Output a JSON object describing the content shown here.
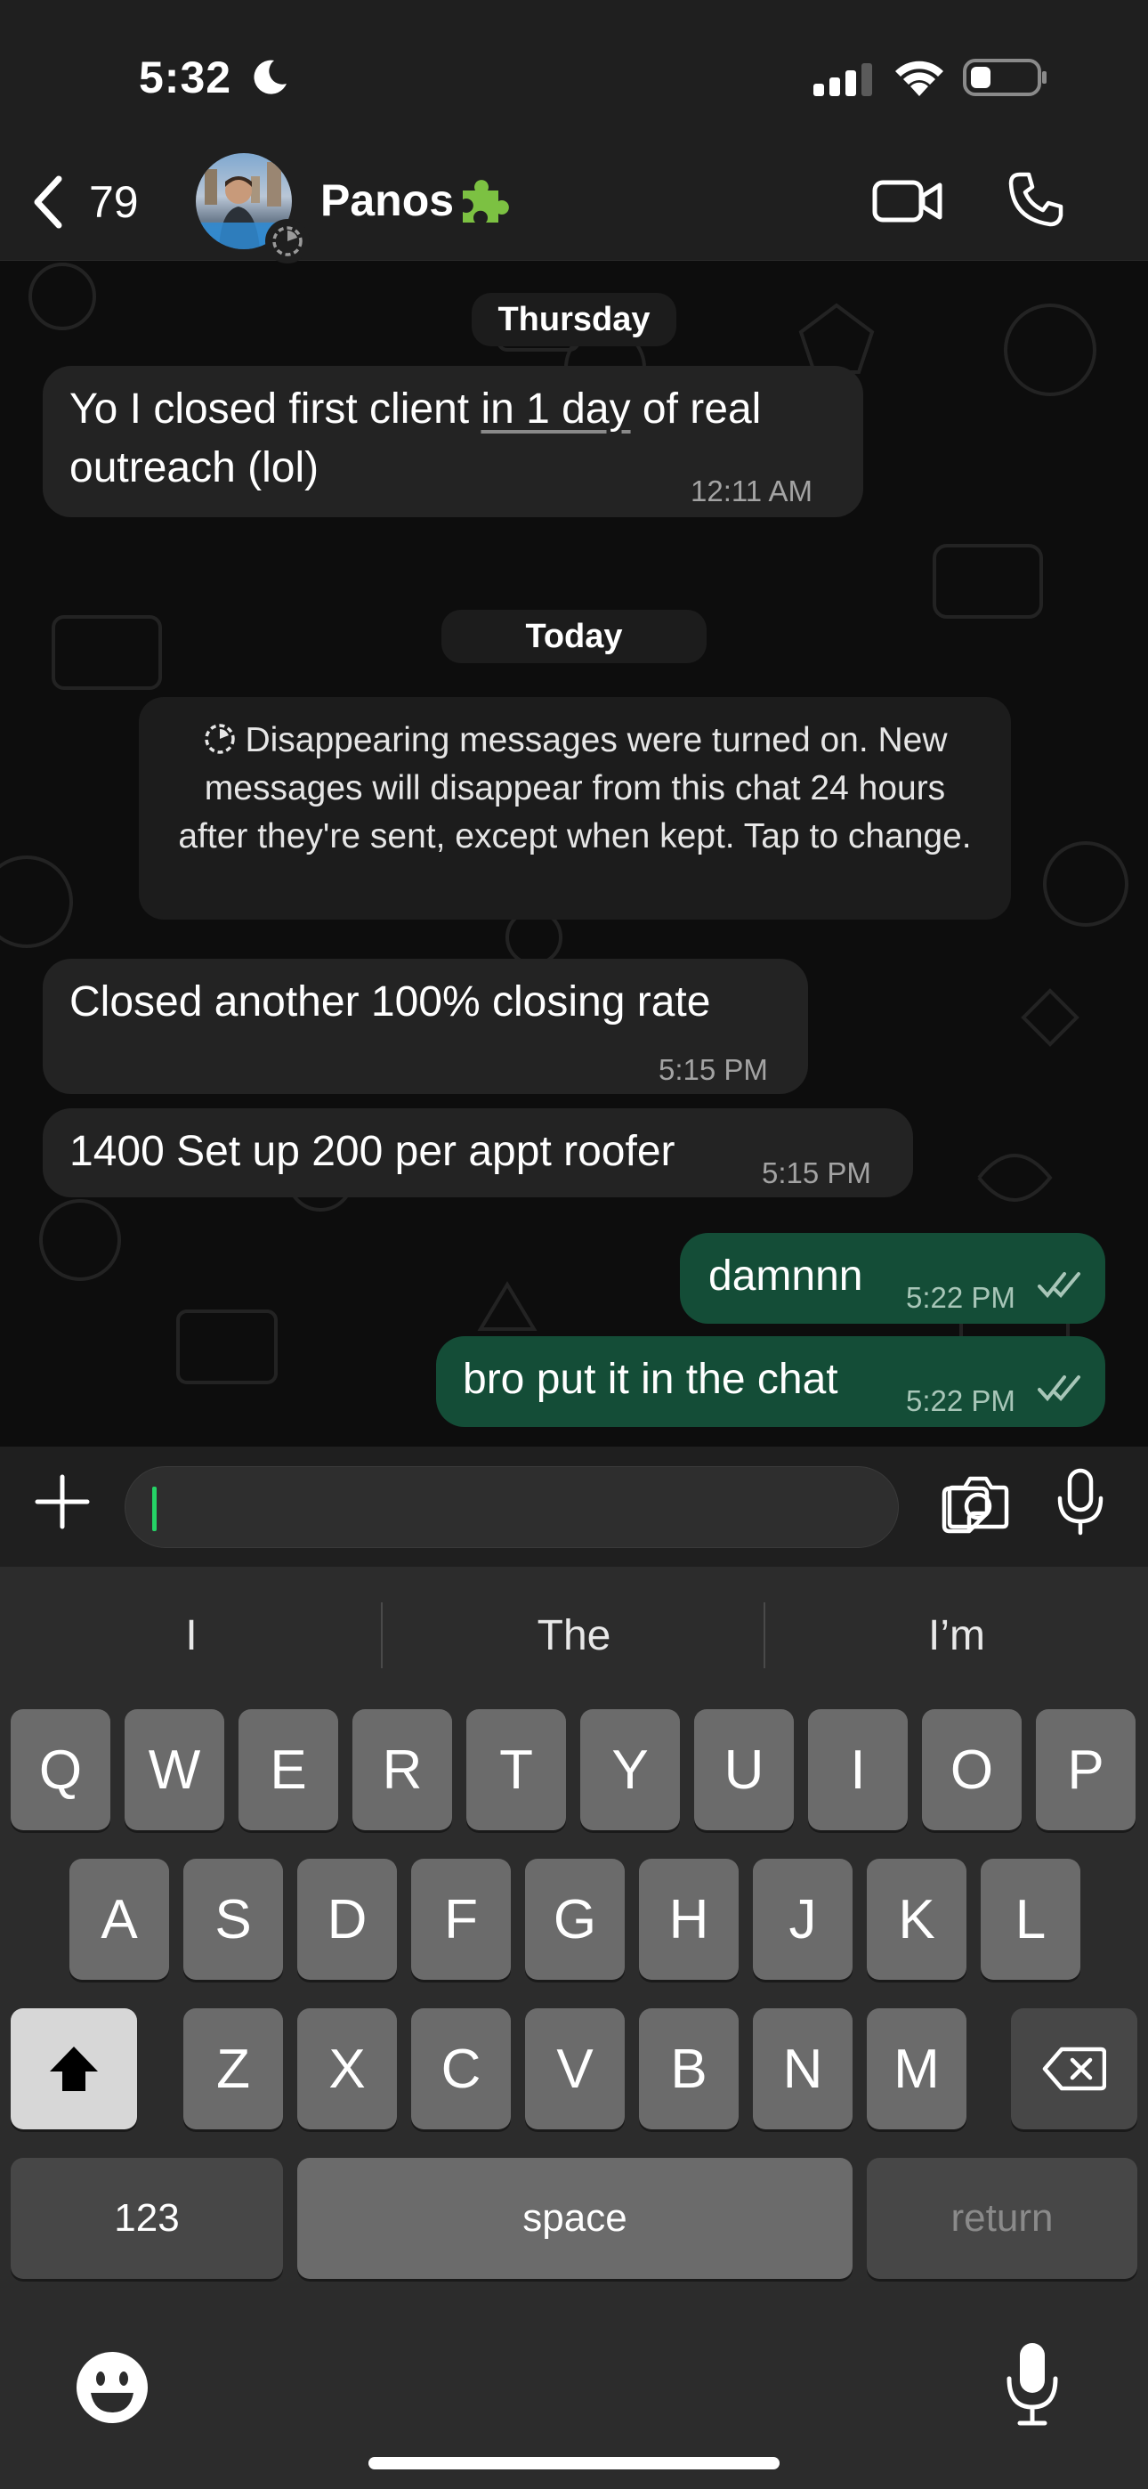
{
  "status": {
    "time": "5:32"
  },
  "header": {
    "back_count": "79",
    "contact_name": "Panos"
  },
  "chat": {
    "date_thursday": "Thursday",
    "date_today": "Today",
    "msg1": {
      "text_a": "Yo I closed first client ",
      "text_u": "in 1 day",
      "text_b": " of real outreach (lol)",
      "time": "12:11 AM"
    },
    "system_note": "Disappearing messages were turned on. New messages will disappear from this chat 24 hours after they're sent, except when kept. Tap to change.",
    "msg2": {
      "text": "Closed another 100% closing rate",
      "time": "5:15 PM"
    },
    "msg3": {
      "text": "1400 Set up 200 per appt roofer",
      "time": "5:15 PM"
    },
    "msg4": {
      "text": "damnnn",
      "time": "5:22 PM"
    },
    "msg5": {
      "text": "bro put it in the chat",
      "time": "5:22 PM"
    }
  },
  "keyboard": {
    "suggestions": [
      "I",
      "The",
      "I’m"
    ],
    "row1": [
      "Q",
      "W",
      "E",
      "R",
      "T",
      "Y",
      "U",
      "I",
      "O",
      "P"
    ],
    "row2": [
      "A",
      "S",
      "D",
      "F",
      "G",
      "H",
      "J",
      "K",
      "L"
    ],
    "row3": [
      "Z",
      "X",
      "C",
      "V",
      "B",
      "N",
      "M"
    ],
    "numbers_label": "123",
    "space_label": "space",
    "return_label": "return"
  },
  "colors": {
    "outgoing_bubble": "#144d37",
    "incoming_bubble": "#232323",
    "accent": "#25d366"
  }
}
